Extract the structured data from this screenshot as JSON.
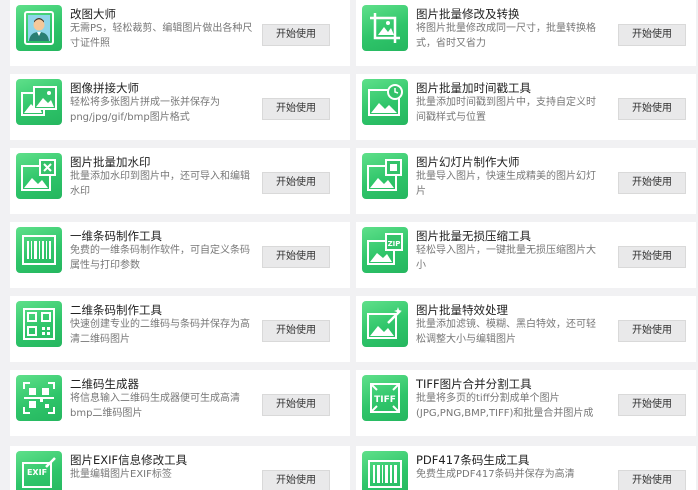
{
  "tools": [
    {
      "title": "改图大师",
      "desc": "无需PS，轻松裁剪、编辑图片做出各种尺寸证件照",
      "button": "开始使用",
      "icon": "id-photo-icon"
    },
    {
      "title": "图片批量修改及转换",
      "desc": "将图片批量修改成同一尺寸，批量转换格式，省时又省力",
      "button": "开始使用",
      "icon": "crop-icon"
    },
    {
      "title": "图像拼接大师",
      "desc": "轻松将多张图片拼成一张并保存为png/jpg/gif/bmp图片格式",
      "button": "开始使用",
      "icon": "image-stitch-icon"
    },
    {
      "title": "图片批量加时间戳工具",
      "desc": "批量添加时间戳到图片中，支持自定义时间戳样式与位置",
      "button": "开始使用",
      "icon": "image-clock-icon"
    },
    {
      "title": "图片批量加水印",
      "desc": "批量添加水印到图片中，还可导入和编辑水印",
      "button": "开始使用",
      "icon": "watermark-icon"
    },
    {
      "title": "图片幻灯片制作大师",
      "desc": "批量导入图片，快速生成精美的图片幻灯片",
      "button": "开始使用",
      "icon": "slideshow-icon"
    },
    {
      "title": "一维条码制作工具",
      "desc": "免费的一维条码制作软件，可自定义条码属性与打印参数",
      "button": "开始使用",
      "icon": "barcode-icon"
    },
    {
      "title": "图片批量无损压缩工具",
      "desc": "轻松导入图片，一键批量无损压缩图片大小",
      "button": "开始使用",
      "icon": "zip-image-icon"
    },
    {
      "title": "二维条码制作工具",
      "desc": "快速创建专业的二维码与条码并保存为高清二维码图片",
      "button": "开始使用",
      "icon": "qr-code-icon"
    },
    {
      "title": "图片批量特效处理",
      "desc": "批量添加滤镜、模糊、黑白特效，还可轻松调整大小与编辑图片",
      "button": "开始使用",
      "icon": "magic-wand-icon"
    },
    {
      "title": "二维码生成器",
      "desc": "将信息输入二维码生成器便可生成高清bmp二维码图片",
      "button": "开始使用",
      "icon": "qr-generator-icon"
    },
    {
      "title": "TIFF图片合并分割工具",
      "desc": "批量将多页的tiff分割成单个图片(JPG,PNG,BMP,TIFF)和批量合并图片成",
      "button": "开始使用",
      "icon": "tiff-icon"
    },
    {
      "title": "图片EXIF信息修改工具",
      "desc": "批量编辑图片EXIF标签",
      "button": "开始使用",
      "icon": "exif-icon"
    },
    {
      "title": "PDF417条码生成工具",
      "desc": "免费生成PDF417条码并保存为高清",
      "button": "开始使用",
      "icon": "pdf417-icon"
    }
  ]
}
